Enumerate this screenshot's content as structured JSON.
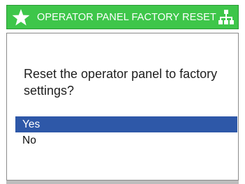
{
  "titlebar": {
    "title": "OPERATOR PANEL FACTORY RESET",
    "left_icon": "star-icon",
    "right_icon": "hierarchy-icon",
    "color": "#3ec64a"
  },
  "dialog": {
    "question": "Reset the operator panel to factory settings?",
    "options": [
      {
        "label": "Yes",
        "selected": true
      },
      {
        "label": "No",
        "selected": false
      }
    ],
    "selection_color": "#2e58a8"
  }
}
